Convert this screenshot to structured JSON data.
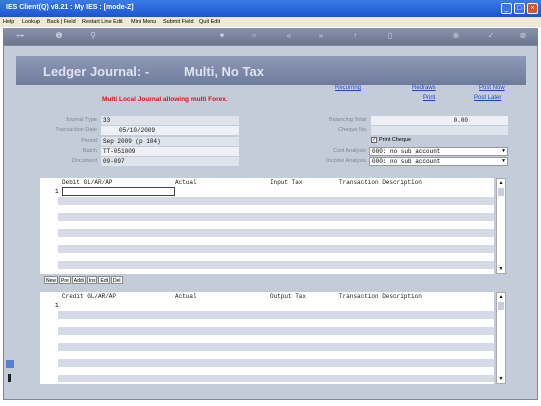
{
  "window": {
    "title": "IES Client(Q) v8.21 : My IES :     [mode-Z]"
  },
  "menu": [
    "Help",
    "Lookup",
    "Back | Field",
    "Restart Line Edit",
    "Mini Menu",
    "Submit Field",
    "Quit Edit"
  ],
  "toolbar_icons": [
    "key-icon",
    "info-icon",
    "search-icon",
    "heart-icon",
    "circle-icon",
    "rewind-icon",
    "forward-icon",
    "up-icon",
    "trash-icon",
    "plus-icon",
    "check-icon",
    "close-icon"
  ],
  "banner": {
    "title": "Ledger Journal: -",
    "subtitle": "Multi, No Tax"
  },
  "links": {
    "recurring": "Recurring",
    "redraws": "Redraws",
    "post_now": "Post Now",
    "print": "Print",
    "post_later": "Post Later"
  },
  "warning": "Multi Local Journal allowing multi Forex.",
  "form": {
    "journal_type_label": "Journal Type",
    "journal_type": "33",
    "transaction_date_label": "Transaction Date",
    "transaction_date": "05/10/2009",
    "period_label": "Period",
    "period": "Sep 2009 (p 104)",
    "batch_label": "Batch",
    "batch": "TT-051009",
    "document_label": "Document",
    "document": "09-097",
    "balancing_total_label": "Balancing Total",
    "balancing_total": "0.00",
    "cheque_no_label": "Cheque No",
    "cheque_no": "",
    "print_cheque_label": "Print Cheque",
    "print_cheque": true,
    "cost_analysis_label": "Cost Analysis",
    "cost_analysis": "000: no sub account",
    "income_analysis_label": "Income Analysis",
    "income_analysis": "000: no sub account"
  },
  "debit_grid": {
    "headers": [
      "Debit GL/AR/AP",
      "Actual",
      "Input Tax",
      "Transaction Description"
    ],
    "first_row_number": "1"
  },
  "grid_buttons": [
    "New",
    "Pre",
    "Addi",
    "Ins",
    "Edt",
    "Del"
  ],
  "credit_grid": {
    "headers": [
      "Credit GL/AR/AP",
      "Actual",
      "Output Tax",
      "Transaction Description"
    ],
    "first_row_number": "1"
  }
}
